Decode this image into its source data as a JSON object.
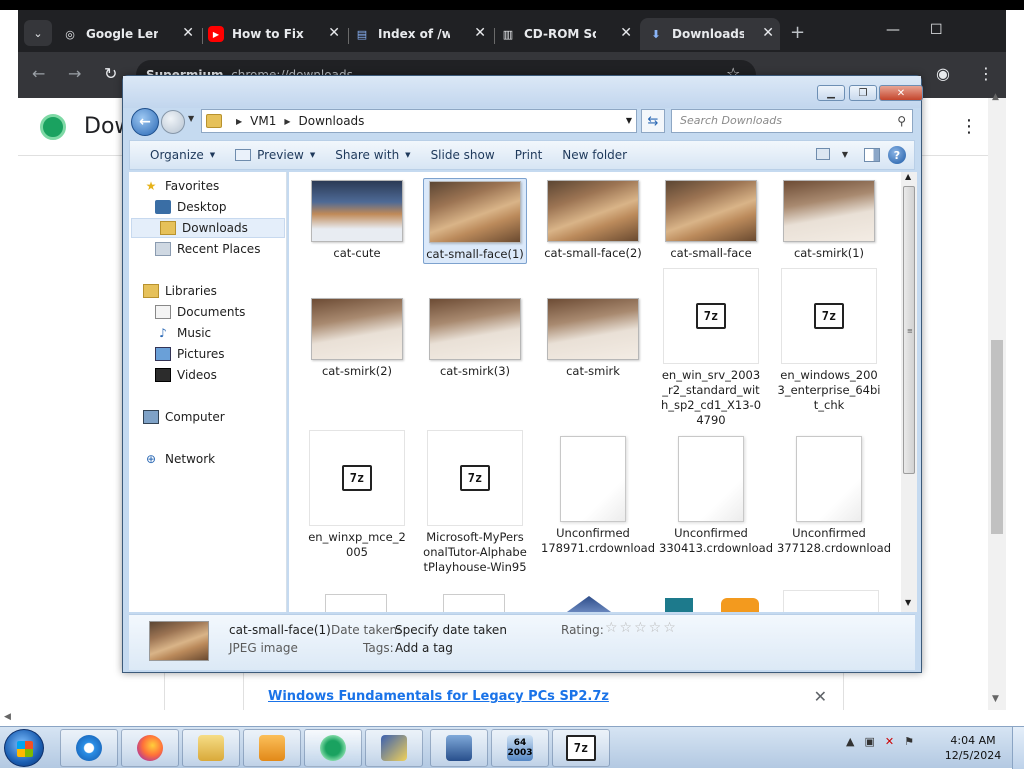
{
  "browser": {
    "tabs": [
      {
        "title": "Google Lens",
        "icon": "google-lens-icon"
      },
      {
        "title": "How to Fix Be",
        "icon": "youtube-icon"
      },
      {
        "title": "Index of /win",
        "icon": "web-page-icon"
      },
      {
        "title": "CD-ROM Soft",
        "icon": "archive-icon"
      },
      {
        "title": "Downloads",
        "icon": "download-icon"
      }
    ],
    "omnibox_prefix": "Supermium",
    "omnibox_url": "chrome://downloads",
    "page_title": "Dow",
    "download_link": "Windows Fundamentals for Legacy PCs SP2.7z"
  },
  "explorer": {
    "breadcrumb": [
      "VM1",
      "Downloads"
    ],
    "search_placeholder": "Search Downloads",
    "commands": [
      {
        "label": "Organize",
        "dropdown": true
      },
      {
        "label": "Preview",
        "dropdown": true,
        "icon": "preview-icon"
      },
      {
        "label": "Share with",
        "dropdown": true
      },
      {
        "label": "Slide show",
        "dropdown": false
      },
      {
        "label": "Print",
        "dropdown": false
      },
      {
        "label": "New folder",
        "dropdown": false
      }
    ],
    "nav": {
      "favorites": "Favorites",
      "desktop": "Desktop",
      "downloads": "Downloads",
      "recent": "Recent Places",
      "libraries": "Libraries",
      "documents": "Documents",
      "music": "Music",
      "pictures": "Pictures",
      "videos": "Videos",
      "computer": "Computer",
      "network": "Network"
    },
    "files": [
      {
        "name": "cat-cute",
        "kind": "photo-cute"
      },
      {
        "name": "cat-small-face(1)",
        "kind": "photo-cat",
        "selected": true
      },
      {
        "name": "cat-small-face(2)",
        "kind": "photo-cat"
      },
      {
        "name": "cat-small-face",
        "kind": "photo-cat"
      },
      {
        "name": "cat-smirk(1)",
        "kind": "photo-smirk"
      },
      {
        "name": "cat-smirk(2)",
        "kind": "photo-smirk"
      },
      {
        "name": "cat-smirk(3)",
        "kind": "photo-smirk"
      },
      {
        "name": "cat-smirk",
        "kind": "photo-smirk"
      },
      {
        "name": "en_win_srv_2003_r2_standard_with_sp2_cd1_X13-04790",
        "kind": "7z"
      },
      {
        "name": "en_windows_2003_enterprise_64bit_chk",
        "kind": "7z"
      },
      {
        "name": "en_winxp_mce_2005",
        "kind": "7z"
      },
      {
        "name": "Microsoft-MyPersonalTutor-AlphabetPlayhouse-Win95",
        "kind": "7z"
      },
      {
        "name": "Unconfirmed 178971.crdownload",
        "kind": "blank"
      },
      {
        "name": "Unconfirmed 330413.crdownload",
        "kind": "blank"
      },
      {
        "name": "Unconfirmed 377128.crdownload",
        "kind": "blank"
      }
    ],
    "details": {
      "name": "cat-small-face(1)",
      "type": "JPEG image",
      "date_label": "Date taken:",
      "date_value": "Specify date taken",
      "tags_label": "Tags:",
      "tags_value": "Add a tag",
      "rating_label": "Rating:",
      "stars": "☆☆☆☆☆"
    }
  },
  "taskbar": {
    "apps": [
      "internet-explorer",
      "firefox",
      "file-explorer",
      "media-player",
      "supermium",
      "winrar",
      "virtualbox",
      "windows-2003-image",
      "7zip"
    ],
    "time": "4:04 AM",
    "date": "12/5/2024",
    "app_2003_label": "2003",
    "app_64_label": "64"
  },
  "colors": {
    "chrome_bg": "#202124",
    "link": "#1a73e8",
    "explorer_frame": "#c5daf0"
  }
}
